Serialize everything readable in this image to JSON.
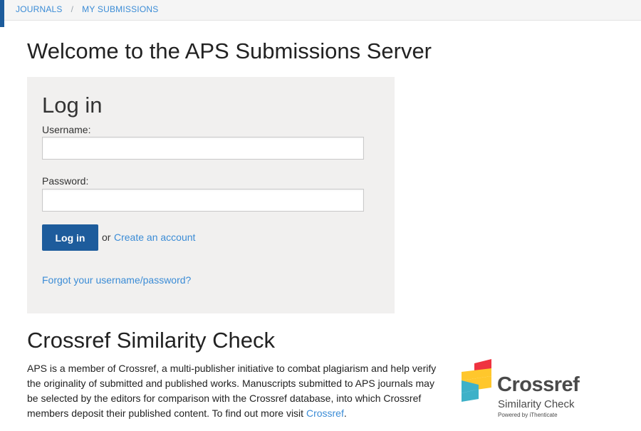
{
  "breadcrumb": {
    "items": [
      "JOURNALS",
      "MY SUBMISSIONS"
    ],
    "separator": "/"
  },
  "page": {
    "title": "Welcome to the APS Submissions Server"
  },
  "login": {
    "title": "Log in",
    "username_label": "Username:",
    "username_value": "",
    "password_label": "Password:",
    "password_value": "",
    "submit_label": "Log in",
    "or_text": "or",
    "create_account_label": "Create an account",
    "forgot_label": "Forgot your username/password?"
  },
  "similarity": {
    "title": "Crossref Similarity Check",
    "body_text": "APS is a member of Crossref, a multi-publisher initiative to combat plagiarism and help verify the originality of submitted and published works. Manuscripts submitted to APS journals may be selected by the editors for comparison with the Crossref database, into which Crossref members deposit their published content. To find out more visit ",
    "link_label": "Crossref",
    "trailing": "."
  },
  "logo": {
    "wordmark": "Crossref",
    "subtitle": "Similarity Check",
    "powered": "Powered by iThenticate",
    "colors": {
      "red": "#ef3340",
      "yellow": "#ffc72c",
      "teal": "#3eb1c8",
      "gray": "#4a4a4a"
    }
  },
  "colors": {
    "accent": "#1d5c9c",
    "link": "#3b8cd6",
    "panel_bg": "#f1f0ef"
  }
}
